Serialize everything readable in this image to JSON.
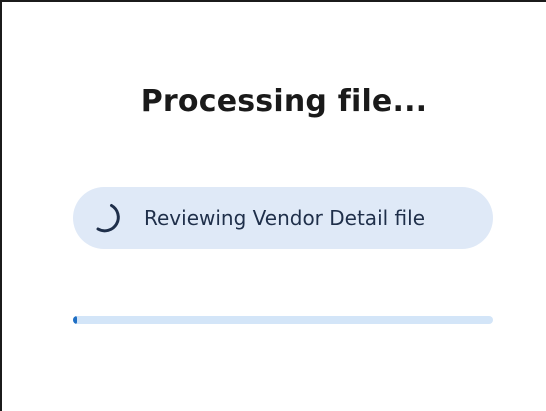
{
  "dialog": {
    "title": "Processing file...",
    "status_text": "Reviewing Vendor Detail file",
    "status_icon": "loading-spinner-icon",
    "progress_fraction": 0.01
  },
  "colors": {
    "pill_background": "#dfe9f7",
    "progress_track": "#d3e5f8",
    "progress_fill": "#1f6fc4",
    "spinner": "#1f2f4a"
  }
}
